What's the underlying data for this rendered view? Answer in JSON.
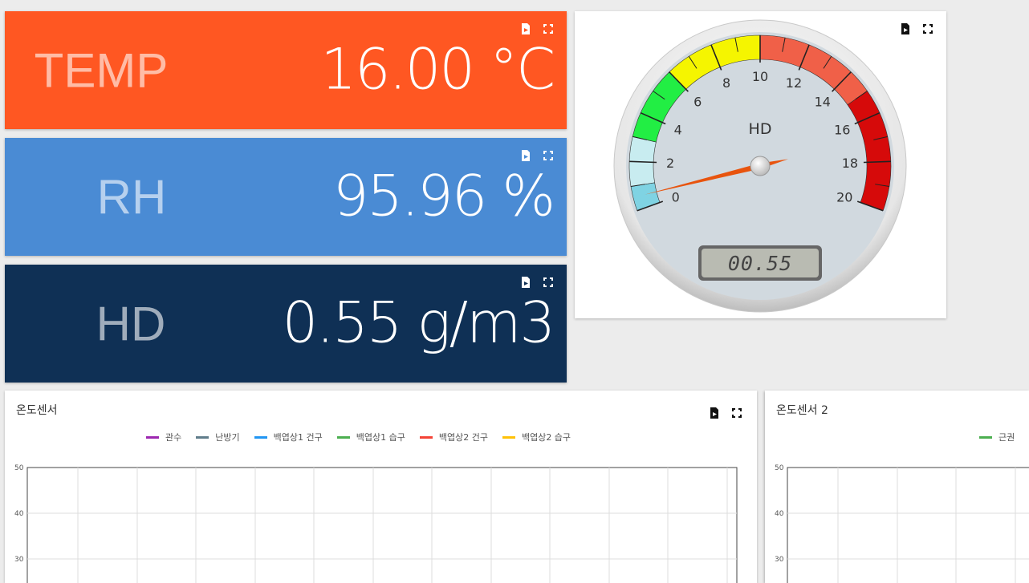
{
  "colors": {
    "temp_bg": "#ff5722",
    "rh_bg": "#4a8bd4",
    "hd_bg": "#0f3055",
    "gauge_face": "#d1d9df",
    "needle": "#e8540e"
  },
  "icons": [
    "export-icon",
    "fullscreen-icon"
  ],
  "metrics": [
    {
      "label": "TEMP",
      "value": "16.00 °C"
    },
    {
      "label": "RH",
      "value": "95.96 %"
    },
    {
      "label": "HD",
      "value": "0.55 g/m3"
    }
  ],
  "gauge": {
    "title": "HD",
    "value": 0.55,
    "display": "00.55",
    "min": 0,
    "max": 20,
    "ticks": [
      "0",
      "2",
      "4",
      "6",
      "8",
      "10",
      "12",
      "14",
      "16",
      "18",
      "20"
    ],
    "bands": [
      {
        "from": 0,
        "to": 1,
        "color": "#7fd3e3"
      },
      {
        "from": 1,
        "to": 3,
        "color": "#c8ecf0"
      },
      {
        "from": 3,
        "to": 6,
        "color": "#22ee44"
      },
      {
        "from": 6,
        "to": 10,
        "color": "#f5f500"
      },
      {
        "from": 10,
        "to": 15,
        "color": "#f06048"
      },
      {
        "from": 15,
        "to": 20,
        "color": "#d60a0a"
      }
    ]
  },
  "chart1": {
    "title": "온도센서",
    "legend": [
      {
        "name": "관수",
        "color": "#9c27b0"
      },
      {
        "name": "난방기",
        "color": "#607d8b"
      },
      {
        "name": "백엽상1 건구",
        "color": "#2196f3"
      },
      {
        "name": "백엽상1 습구",
        "color": "#4caf50"
      },
      {
        "name": "백엽상2 건구",
        "color": "#f44336"
      },
      {
        "name": "백엽상2 습구",
        "color": "#ffc107"
      }
    ],
    "yticks": [
      "50",
      "40",
      "30"
    ]
  },
  "chart2": {
    "title": "온도센서 2",
    "legend": [
      {
        "name": "근권",
        "color": "#4caf50"
      }
    ],
    "yticks": [
      "50",
      "40",
      "30"
    ]
  }
}
